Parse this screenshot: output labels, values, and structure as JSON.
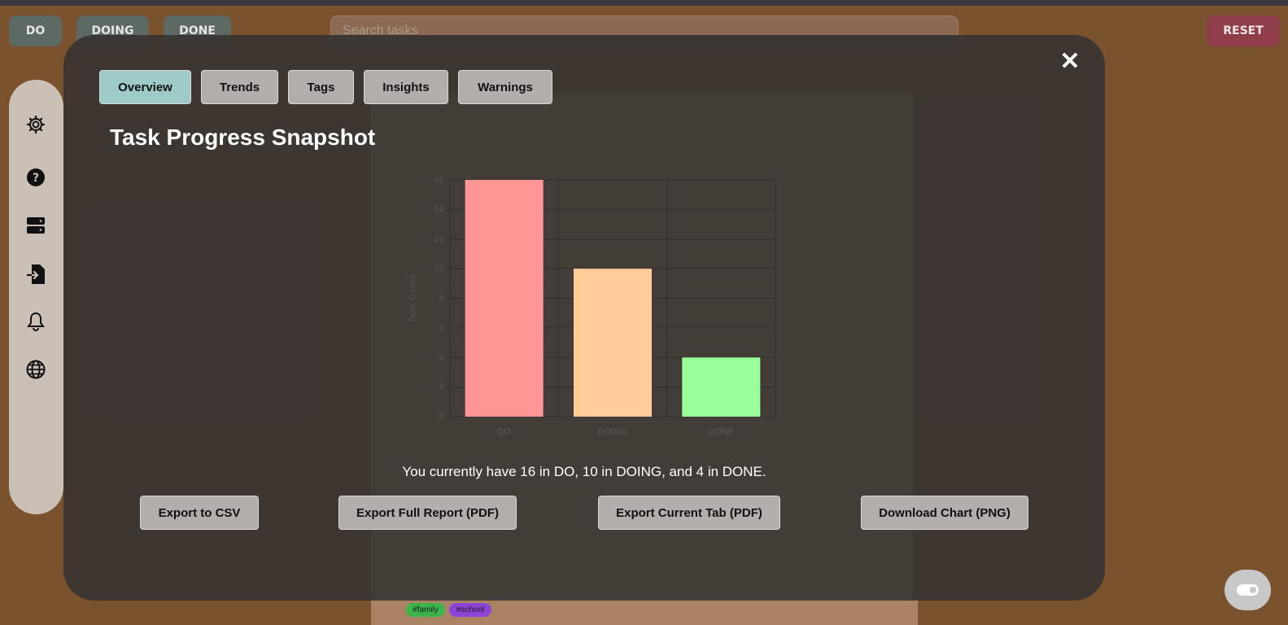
{
  "filters": {
    "do_label": "DO",
    "doing_label": "DOING",
    "done_label": "DONE"
  },
  "search": {
    "placeholder": "Search tasks"
  },
  "reset_label": "RESET",
  "sidebar": {
    "icons": [
      "gear-icon",
      "help-icon",
      "storage-icon",
      "import-icon",
      "bell-icon",
      "globe-icon"
    ]
  },
  "background_tags": [
    "#family",
    "#school"
  ],
  "modal": {
    "close_label": "✕",
    "tabs": [
      "Overview",
      "Trends",
      "Tags",
      "Insights",
      "Warnings"
    ],
    "active_tab": "Overview",
    "title": "Task Progress Snapshot",
    "summary": "You currently have 16 in DO, 10 in DOING, and 4 in DONE.",
    "exports": [
      "Export to CSV",
      "Export Full Report (PDF)",
      "Export Current Tab (PDF)",
      "Download Chart (PNG)"
    ]
  },
  "chart_data": {
    "type": "bar",
    "categories": [
      "DO",
      "DOING",
      "DONE"
    ],
    "values": [
      16,
      10,
      4
    ],
    "colors": [
      "#ff9696",
      "#ffcc99",
      "#99ff99"
    ],
    "ylabel": "Task Count",
    "xlabel": "",
    "ylim": [
      0,
      16
    ],
    "yticks": [
      0,
      2,
      4,
      6,
      8,
      10,
      12,
      14,
      16
    ],
    "grid": true
  }
}
